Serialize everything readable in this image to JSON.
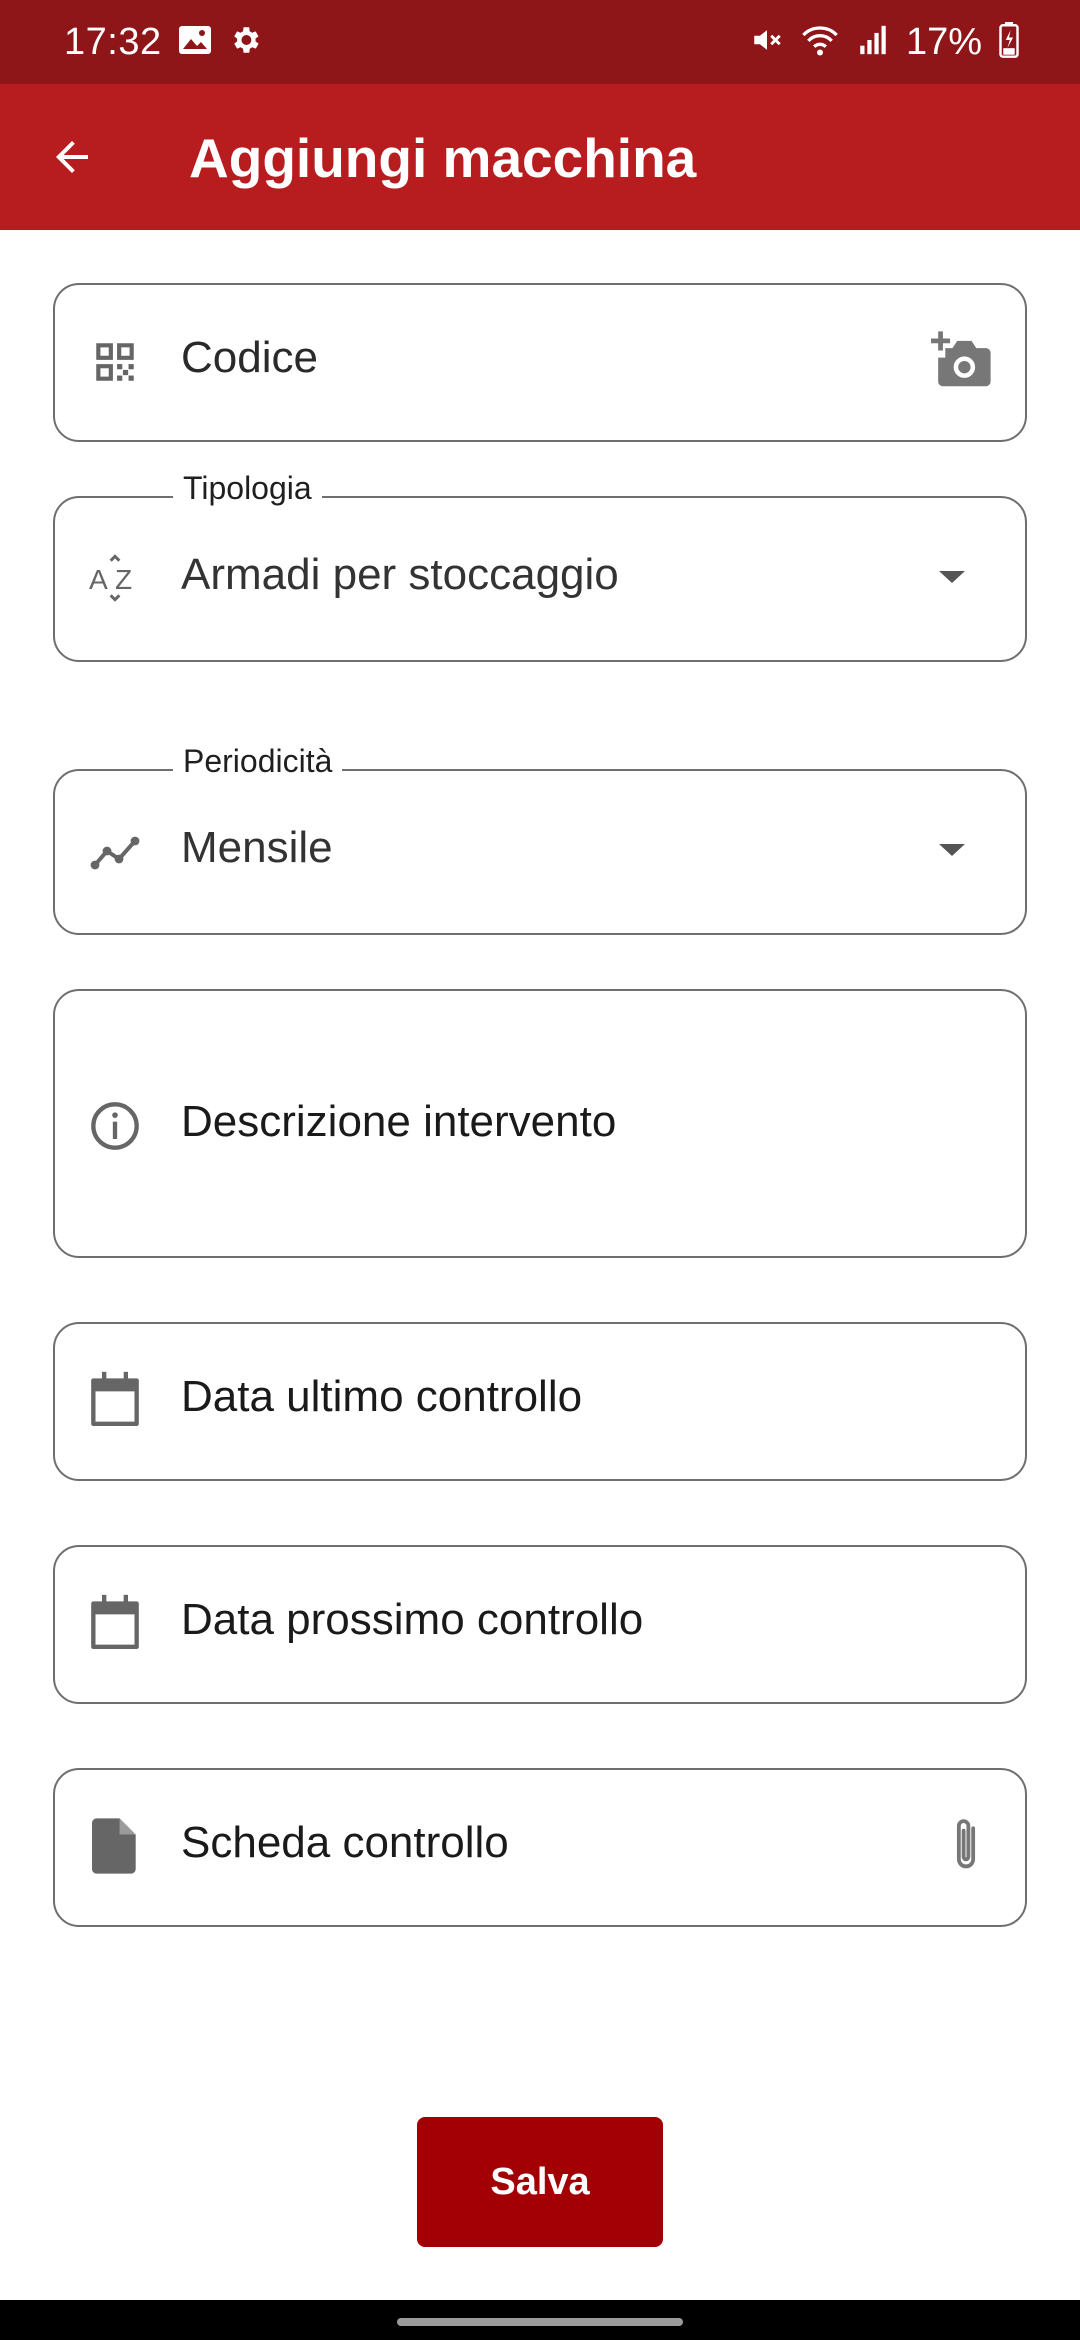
{
  "status_bar": {
    "time": "17:32",
    "battery": "17%",
    "icons": [
      "image-icon",
      "settings-icon",
      "mute-icon",
      "wifi-icon",
      "signal-icon",
      "battery-charging-icon"
    ]
  },
  "app_bar": {
    "title": "Aggiungi macchina",
    "back_icon": "arrow-back-icon"
  },
  "form": {
    "code": {
      "placeholder": "Codice",
      "icon": "qr-code-icon",
      "action_icon": "add-photo-icon"
    },
    "type": {
      "label": "Tipologia",
      "value": "Armadi per stoccaggio",
      "icon": "sort-az-icon"
    },
    "frequency": {
      "label": "Periodicità",
      "value": "Mensile",
      "icon": "trend-line-icon"
    },
    "description": {
      "placeholder": "Descrizione intervento",
      "icon": "info-icon"
    },
    "last_check": {
      "placeholder": "Data ultimo controllo",
      "icon": "calendar-icon"
    },
    "next_check": {
      "placeholder": "Data prossimo controllo",
      "icon": "calendar-icon"
    },
    "check_sheet": {
      "placeholder": "Scheda controllo",
      "icon": "file-icon",
      "action_icon": "paperclip-icon"
    }
  },
  "actions": {
    "save_label": "Salva"
  },
  "colors": {
    "status_bar": "#8e1518",
    "app_bar": "#b71c1f",
    "save_button": "#a30005",
    "field_border": "#6f6f6f",
    "icon_grey": "#666666"
  }
}
